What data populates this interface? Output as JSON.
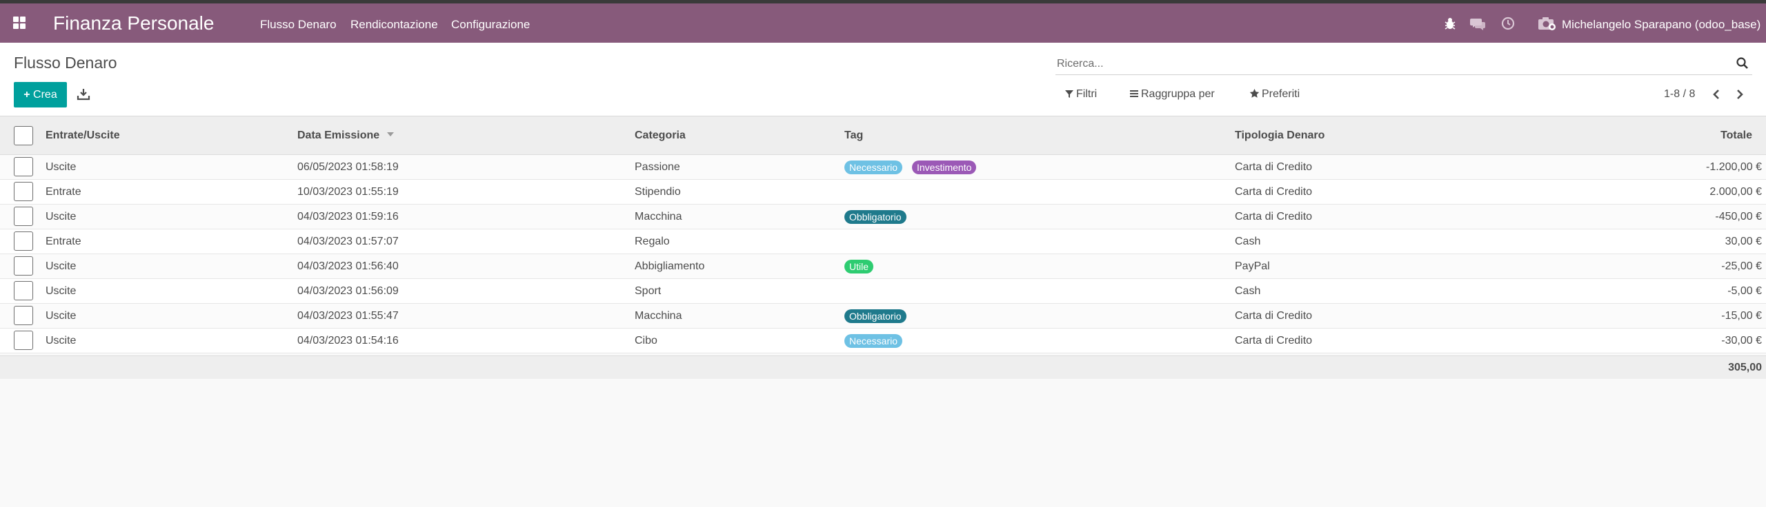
{
  "navbar": {
    "app_name": "Finanza Personale",
    "menus": [
      "Flusso Denaro",
      "Rendicontazione",
      "Configurazione"
    ],
    "user": "Michelangelo Sparapano (odoo_base)",
    "icons": [
      "apps-icon",
      "bug-icon",
      "chat-icon",
      "clock-icon",
      "camera-icon"
    ]
  },
  "control_panel": {
    "title": "Flusso Denaro",
    "create_label": "Crea",
    "search_placeholder": "Ricerca...",
    "filters_label": "Filtri",
    "groupby_label": "Raggruppa per",
    "favorites_label": "Preferiti",
    "pager": "1-8 / 8"
  },
  "table": {
    "columns": [
      "Entrate/Uscite",
      "Data Emissione",
      "Categoria",
      "Tag",
      "Tipologia Denaro",
      "Totale"
    ],
    "rows": [
      {
        "tipo": "Uscite",
        "data": "06/05/2023 01:58:19",
        "categoria": "Passione",
        "tags": [
          "Necessario",
          "Investimento"
        ],
        "tipologia": "Carta di Credito",
        "totale": "-1.200,00 €"
      },
      {
        "tipo": "Entrate",
        "data": "10/03/2023 01:55:19",
        "categoria": "Stipendio",
        "tags": [],
        "tipologia": "Carta di Credito",
        "totale": "2.000,00 €"
      },
      {
        "tipo": "Uscite",
        "data": "04/03/2023 01:59:16",
        "categoria": "Macchina",
        "tags": [
          "Obbligatorio"
        ],
        "tipologia": "Carta di Credito",
        "totale": "-450,00 €"
      },
      {
        "tipo": "Entrate",
        "data": "04/03/2023 01:57:07",
        "categoria": "Regalo",
        "tags": [],
        "tipologia": "Cash",
        "totale": "30,00 €"
      },
      {
        "tipo": "Uscite",
        "data": "04/03/2023 01:56:40",
        "categoria": "Abbigliamento",
        "tags": [
          "Utile"
        ],
        "tipologia": "PayPal",
        "totale": "-25,00 €"
      },
      {
        "tipo": "Uscite",
        "data": "04/03/2023 01:56:09",
        "categoria": "Sport",
        "tags": [],
        "tipologia": "Cash",
        "totale": "-5,00 €"
      },
      {
        "tipo": "Uscite",
        "data": "04/03/2023 01:55:47",
        "categoria": "Macchina",
        "tags": [
          "Obbligatorio"
        ],
        "tipologia": "Carta di Credito",
        "totale": "-15,00 €"
      },
      {
        "tipo": "Uscite",
        "data": "04/03/2023 01:54:16",
        "categoria": "Cibo",
        "tags": [
          "Necessario"
        ],
        "tipologia": "Carta di Credito",
        "totale": "-30,00 €"
      }
    ],
    "total": "305,00"
  },
  "colors": {
    "navbar": "#875a7b",
    "primary_button": "#00a09d",
    "tag_necessario": "#6ec1e4",
    "tag_investimento": "#9b59b6",
    "tag_obbligatorio": "#1f7a8c",
    "tag_utile": "#2ecc71"
  }
}
